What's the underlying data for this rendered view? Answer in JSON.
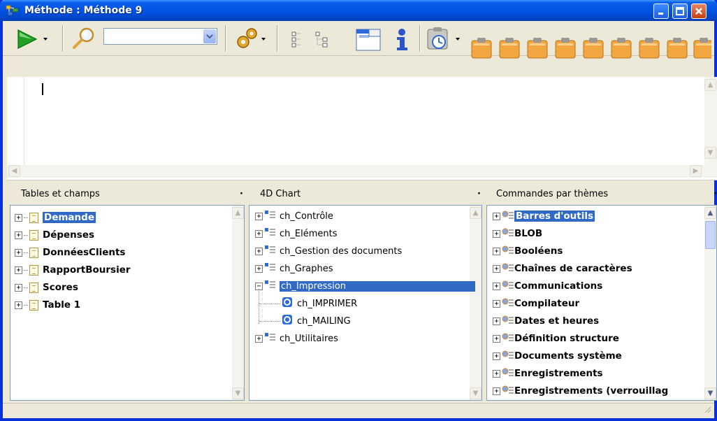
{
  "window": {
    "title": "Méthode : Méthode 9"
  },
  "toolbar": {
    "search_value": ""
  },
  "panes": {
    "tables": {
      "header": "Tables et champs",
      "items": [
        {
          "label": "Demande",
          "selected": true
        },
        {
          "label": "Dépenses"
        },
        {
          "label": "DonnéesClients"
        },
        {
          "label": "RapportBoursier"
        },
        {
          "label": "Scores"
        },
        {
          "label": "Table 1"
        }
      ]
    },
    "chart": {
      "header": "4D Chart",
      "items": [
        {
          "label": "ch_Contrôle"
        },
        {
          "label": "ch_Eléments"
        },
        {
          "label": "ch_Gestion des documents"
        },
        {
          "label": "ch_Graphes"
        },
        {
          "label": "ch_Impression",
          "selected": true,
          "expanded": true
        },
        {
          "label": "ch_IMPRIMER",
          "child": true
        },
        {
          "label": "ch_MAILING",
          "child": true
        },
        {
          "label": "ch_Utilitaires"
        }
      ]
    },
    "commands": {
      "header": "Commandes par thèmes",
      "items": [
        {
          "label": "Barres d'outils",
          "selected": true
        },
        {
          "label": "BLOB"
        },
        {
          "label": "Booléens"
        },
        {
          "label": "Chaînes de caractères"
        },
        {
          "label": "Communications"
        },
        {
          "label": "Compilateur"
        },
        {
          "label": "Dates et heures"
        },
        {
          "label": "Définition structure"
        },
        {
          "label": "Documents système"
        },
        {
          "label": "Enregistrements"
        },
        {
          "label": "Enregistrements (verrouillag"
        }
      ]
    }
  }
}
